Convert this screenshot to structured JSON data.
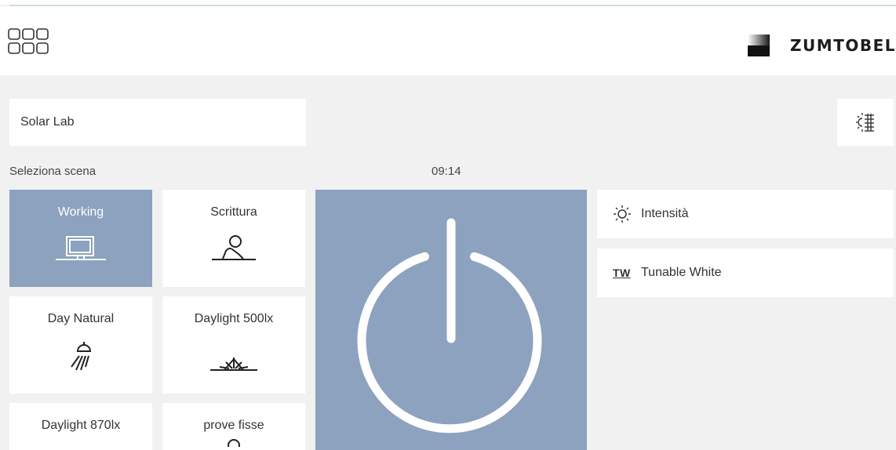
{
  "header": {
    "brand": "ZUMTOBEL"
  },
  "room": {
    "name": "Solar Lab"
  },
  "scene_section": {
    "label": "Seleziona scena",
    "time": "09:14"
  },
  "scenes": [
    {
      "label": "Working",
      "icon": "monitor-icon",
      "active": true
    },
    {
      "label": "Scrittura",
      "icon": "person-at-desk-icon",
      "active": false
    },
    {
      "label": "Day Natural",
      "icon": "lamp-icon",
      "active": false
    },
    {
      "label": "Daylight 500lx",
      "icon": "sunrise-icon",
      "active": false
    },
    {
      "label": "Daylight 870lx",
      "icon": "",
      "active": false
    },
    {
      "label": "prove fisse",
      "icon": "person-icon",
      "active": false
    }
  ],
  "settings": [
    {
      "label": "Intensità",
      "icon": "sun-icon"
    },
    {
      "label": "Tunable White",
      "icon": "tw-icon",
      "icon_text": "TW"
    }
  ],
  "colors": {
    "accent": "#8ca2bf",
    "background": "#f1f1f2",
    "card": "#ffffff"
  }
}
